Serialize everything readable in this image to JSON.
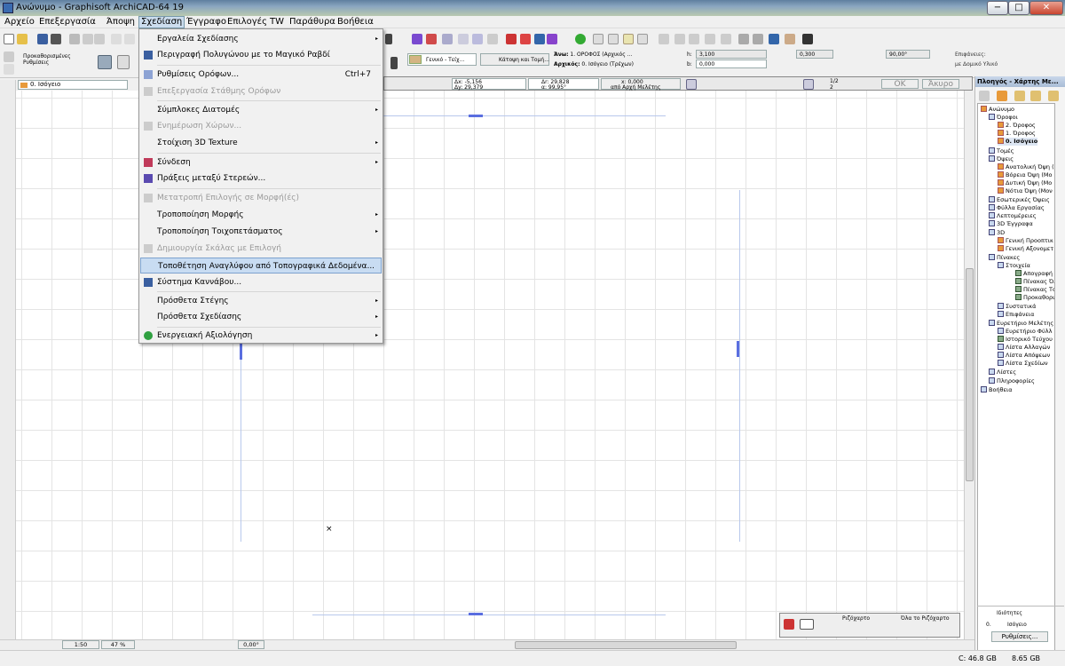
{
  "window": {
    "title": "Ανώνυμο - Graphisoft ArchiCAD-64 19",
    "minimize": "−",
    "maximize": "□",
    "close": "✕"
  },
  "menubar": [
    "Αρχείο",
    "Επεξεργασία",
    "Άποψη",
    "Σχεδίαση",
    "Έγγραφο",
    "Επιλογές",
    "TW",
    "Παράθυρα",
    "Βοήθεια"
  ],
  "toolbox": {
    "title": "Προκαθορισμένες Ρυθμίσεις"
  },
  "floor_select": "0. Ισόγειο",
  "info_box": {
    "fill_name": "Γενικό - Τείχ...",
    "view_name": "Κάτοψη και Τομή...",
    "top_label": "Άνω:",
    "top_value": "1. ΟΡΟΦΟΣ (Αρχικός ...",
    "home_label": "Αρχικός:",
    "home_value": "0. Ισόγειο (Τρέχων)",
    "h_label": "h:",
    "h_value": "3,100",
    "b_label": "b:",
    "b_value": "0,000",
    "v1": "0,300",
    "angle": "90,00°",
    "surfaces_label": "Επιφάνειες:",
    "surfaces_value": "με Δομικό Υλικό"
  },
  "coords": {
    "dx": "Δx: -5,156",
    "dy": "Δy: 29,379",
    "dr": "Δr: 29,828",
    "a": "α: 99,95°",
    "x": "x: 0,000",
    "y": "από Αρχή Μελέτης",
    "pages": "1/2",
    "pages_b": "2",
    "ok": "OK",
    "cancel": "Άκυρο"
  },
  "dropdown": {
    "items": [
      {
        "label": "Εργαλεία Σχεδίασης",
        "arrow": "▸",
        "disabled": false
      },
      {
        "label": "Περιγραφή Πολυγώνου με το Μαγικό Ραβδί",
        "disabled": false
      },
      {
        "label": "Ρυθμίσεις Ορόφων...",
        "shortcut": "Ctrl+7",
        "disabled": false
      },
      {
        "label": "Επεξεργασία Στάθμης Ορόφων",
        "disabled": true
      },
      {
        "label": "Σύμπλοκες Διατομές",
        "arrow": "▸",
        "disabled": false
      },
      {
        "label": "Ενημέρωση Χώρων...",
        "disabled": true
      },
      {
        "label": "Στοίχιση 3D Texture",
        "arrow": "▸",
        "disabled": false
      },
      {
        "label": "Σύνδεση",
        "arrow": "▸",
        "disabled": false
      },
      {
        "label": "Πράξεις μεταξύ Στερεών...",
        "disabled": false
      },
      {
        "label": "Μετατροπή Επιλογής σε Μορφή(ές)",
        "disabled": true
      },
      {
        "label": "Τροποποίηση Μορφής",
        "arrow": "▸",
        "disabled": false
      },
      {
        "label": "Τροποποίηση Τοιχοπετάσματος",
        "arrow": "▸",
        "disabled": false
      },
      {
        "label": "Δημιουργία Σκάλας με Επιλογή",
        "disabled": true
      },
      {
        "label": "Τοποθέτηση Αναγλύφου από Τοπογραφικά Δεδομένα...",
        "disabled": false
      },
      {
        "label": "Σύστημα Καννάβου...",
        "disabled": false
      },
      {
        "label": "Πρόσθετα Στέγης",
        "arrow": "▸",
        "disabled": false
      },
      {
        "label": "Πρόσθετα Σχεδίασης",
        "arrow": "▸",
        "disabled": false
      },
      {
        "label": "Ενεργειακή Αξιολόγηση",
        "arrow": "▸",
        "disabled": false
      }
    ]
  },
  "navigator": {
    "title": "Πλοηγός - Χάρτης Με...",
    "tree": [
      "Ανώνυμο",
      "Όροφοι",
      "2. Όροφος",
      "1. Όροφος",
      "0. Ισόγειο",
      "Τομές",
      "Όψεις",
      "Ανατολική Όψη (",
      "Βόρεια Όψη (Μο",
      "Δυτική Όψη (Μο",
      "Νότια Όψη (Μον",
      "Εσωτερικές Όψεις",
      "Φύλλα Εργασίας",
      "Λεπτομέρειες",
      "3D Έγγραφα",
      "3D",
      "Γενική Προοπτικ",
      "Γενική Αξονομετ",
      "Πίνακες",
      "Στοιχεία",
      "Απογραφή Α",
      "Πίνακας Όλω",
      "Πίνακας Τοίχ",
      "Προκαθορισμ",
      "Συστατικά",
      "Επιφάνεια",
      "Ευρετήριο Μελέτης",
      "Ευρετήριο Φύλλ",
      "Ιστορικό Τεύχου",
      "Λίστα Αλλαγών",
      "Λίστα Απόψεων",
      "Λίστα Σχεδίων",
      "Λίστες",
      "Πληροφορίες",
      "Βοήθεια"
    ],
    "properties_label": "Ιδιότητες",
    "prop_num": "0.",
    "prop_name": "Ισόγειο",
    "settings_button": "Ρυθμίσεις..."
  },
  "layers_panel": {
    "renovation": "Ριζόχαρτο",
    "all_to_renovation": "Όλα το Ριζόχαρτο"
  },
  "status": {
    "scale": "1:50",
    "zoom": "47 %",
    "angle": "0,00°",
    "disk_c": "C: 46.8 GB",
    "ram": "8.65 GB"
  }
}
